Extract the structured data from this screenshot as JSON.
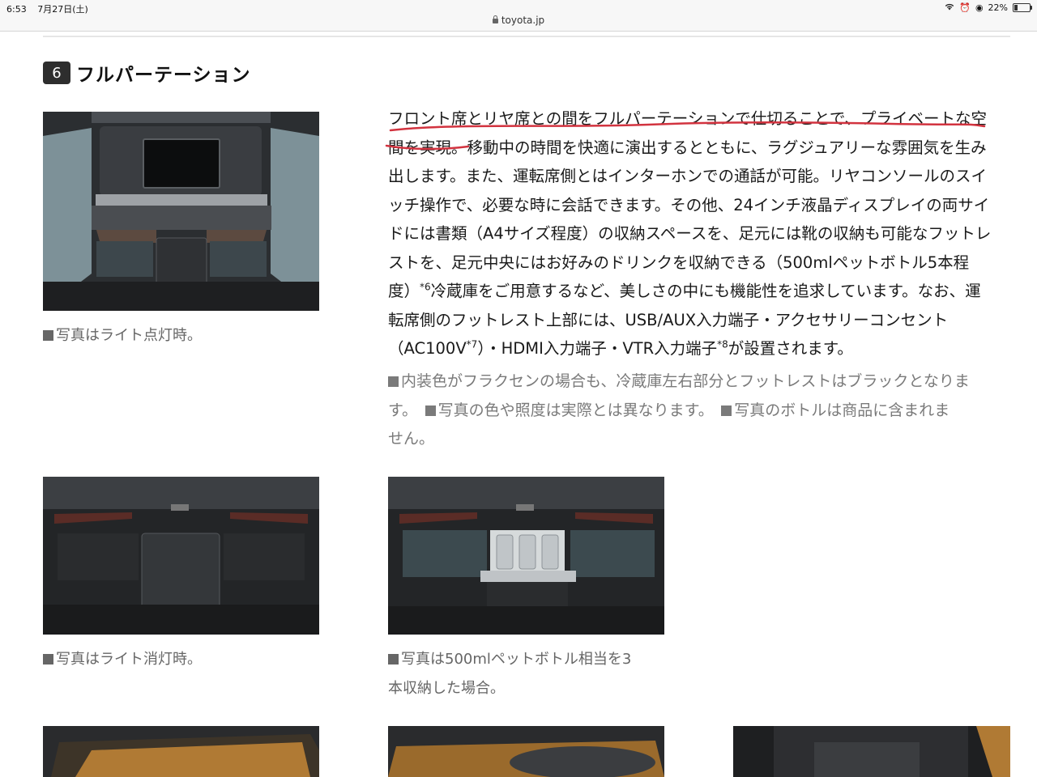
{
  "status_bar": {
    "time": "6:53",
    "date": "7月27日(土)",
    "url": "toyota.jp",
    "battery": "22%",
    "battery_level": 0.22
  },
  "section": {
    "number": "6",
    "title": "フルパーテーション"
  },
  "body_lines": [
    "フロント席とリヤ席との間をフルパーテーションで仕切ることで、プライベートな空",
    "間を実現。移動中の時間を快適に演出するとともに、ラグジュアリーな雰囲気を生み",
    "出します。また、運転席側とはインターホンでの通話が可能。リヤコンソールのスイ",
    "ッチ操作で、必要な時に会話できます。その他、24インチ液晶ディスプレイの両サイ",
    "ドには書類（A4サイズ程度）の収納スペースを、足元には靴の収納も可能なフットレ",
    "ストを、足元中央にはお好みのドリンクを収納できる（500mlペットボトル5本程"
  ],
  "body_line7": {
    "a": "度）",
    "sup": "*6",
    "b": "冷蔵庫をご用意するなど、美しさの中にも機能性を追求しています。なお、運"
  },
  "body_line8": "転席側のフットレスト上部には、USB/AUX入力端子・アクセサリーコンセント",
  "body_line9": {
    "a": "（AC100V",
    "sup1": "*7",
    "b": "）・HDMI入力端子・VTR入力端子",
    "sup2": "*8",
    "c": "が設置されます。"
  },
  "notes": {
    "line1": "内装色がフラクセンの場合も、冷蔵庫左右部分とフットレストはブラックとなりま",
    "line2a": "す。",
    "line2b": "写真の色や照度は実際とは異なります。",
    "line2c": "写真のボトルは商品に含まれま",
    "line3": "せん。"
  },
  "captions": {
    "photo1": "写真はライト点灯時。",
    "photo2": "写真はライト消灯時。",
    "photo3_line1": "写真は500mlペットボトル相当を3",
    "photo3_line2": "本収納した場合。"
  },
  "colors": {
    "annotation_red": "#d2333f",
    "badge_bg": "#2e2e2e",
    "caption_gray": "#666666"
  }
}
